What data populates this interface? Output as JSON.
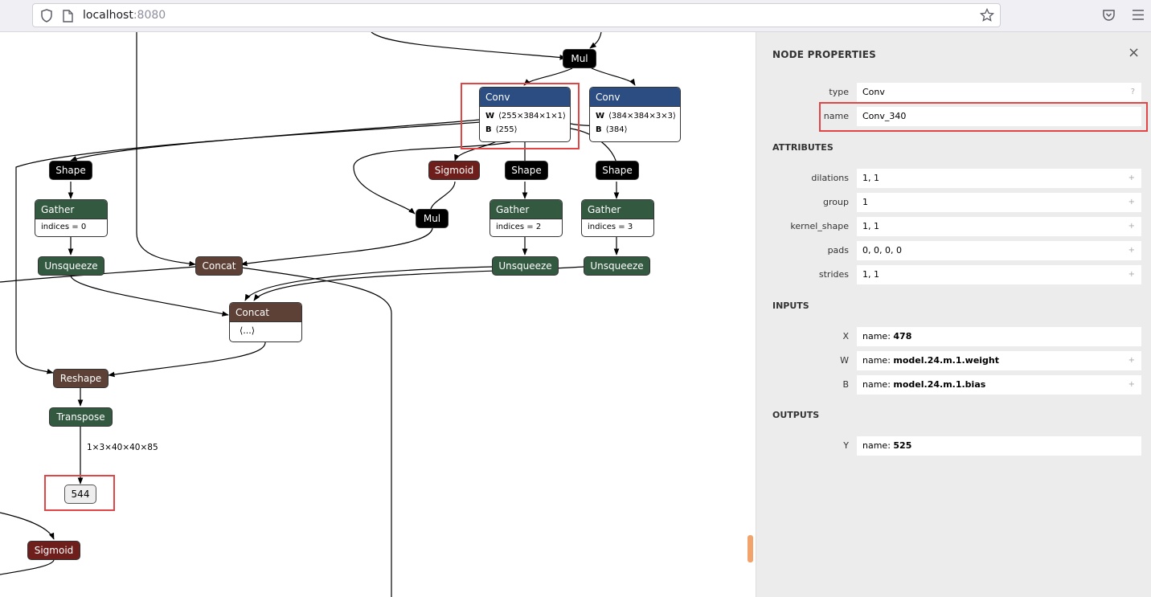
{
  "browser": {
    "url_host": "localhost",
    "url_port": ":8080"
  },
  "graph": {
    "nodes": {
      "mul_top": "Mul",
      "conv1": {
        "title": "Conv",
        "w_key": "W",
        "w_val": "⟨255×384×1×1⟩",
        "b_key": "B",
        "b_val": "⟨255⟩"
      },
      "conv2": {
        "title": "Conv",
        "w_key": "W",
        "w_val": "⟨384×384×3×3⟩",
        "b_key": "B",
        "b_val": "⟨384⟩"
      },
      "shape1": "Shape",
      "shape2": "Shape",
      "shape3": "Shape",
      "sigmoid_top": "Sigmoid",
      "mul_mid": "Mul",
      "gather1": {
        "title": "Gather",
        "attr": "indices = 0"
      },
      "gather2": {
        "title": "Gather",
        "attr": "indices = 2"
      },
      "gather3": {
        "title": "Gather",
        "attr": "indices = 3"
      },
      "unsqueeze1": "Unsqueeze",
      "unsqueeze2": "Unsqueeze",
      "unsqueeze3": "Unsqueeze",
      "concat1": "Concat",
      "concat2": {
        "title": "Concat",
        "body": "⟨...⟩"
      },
      "reshape": "Reshape",
      "transpose": "Transpose",
      "output": "544",
      "sigmoid_bottom": "Sigmoid"
    },
    "edge_label": "1×3×40×40×85"
  },
  "sidebar": {
    "title": "NODE PROPERTIES",
    "close_icon": "×",
    "properties": [
      {
        "label": "type",
        "value": "Conv",
        "extra": "?"
      },
      {
        "label": "name",
        "value": "Conv_340",
        "extra": ""
      }
    ],
    "attributes_header": "ATTRIBUTES",
    "attributes": [
      {
        "label": "dilations",
        "value": "1, 1",
        "extra": "+"
      },
      {
        "label": "group",
        "value": "1",
        "extra": "+"
      },
      {
        "label": "kernel_shape",
        "value": "1, 1",
        "extra": "+"
      },
      {
        "label": "pads",
        "value": "0, 0, 0, 0",
        "extra": "+"
      },
      {
        "label": "strides",
        "value": "1, 1",
        "extra": "+"
      }
    ],
    "inputs_header": "INPUTS",
    "inputs": [
      {
        "label": "X",
        "prefix": "name: ",
        "value": "478",
        "extra": ""
      },
      {
        "label": "W",
        "prefix": "name: ",
        "value": "model.24.m.1.weight",
        "extra": "+"
      },
      {
        "label": "B",
        "prefix": "name: ",
        "value": "model.24.m.1.bias",
        "extra": "+"
      }
    ],
    "outputs_header": "OUTPUTS",
    "outputs": [
      {
        "label": "Y",
        "prefix": "name: ",
        "value": "525",
        "extra": ""
      }
    ]
  }
}
